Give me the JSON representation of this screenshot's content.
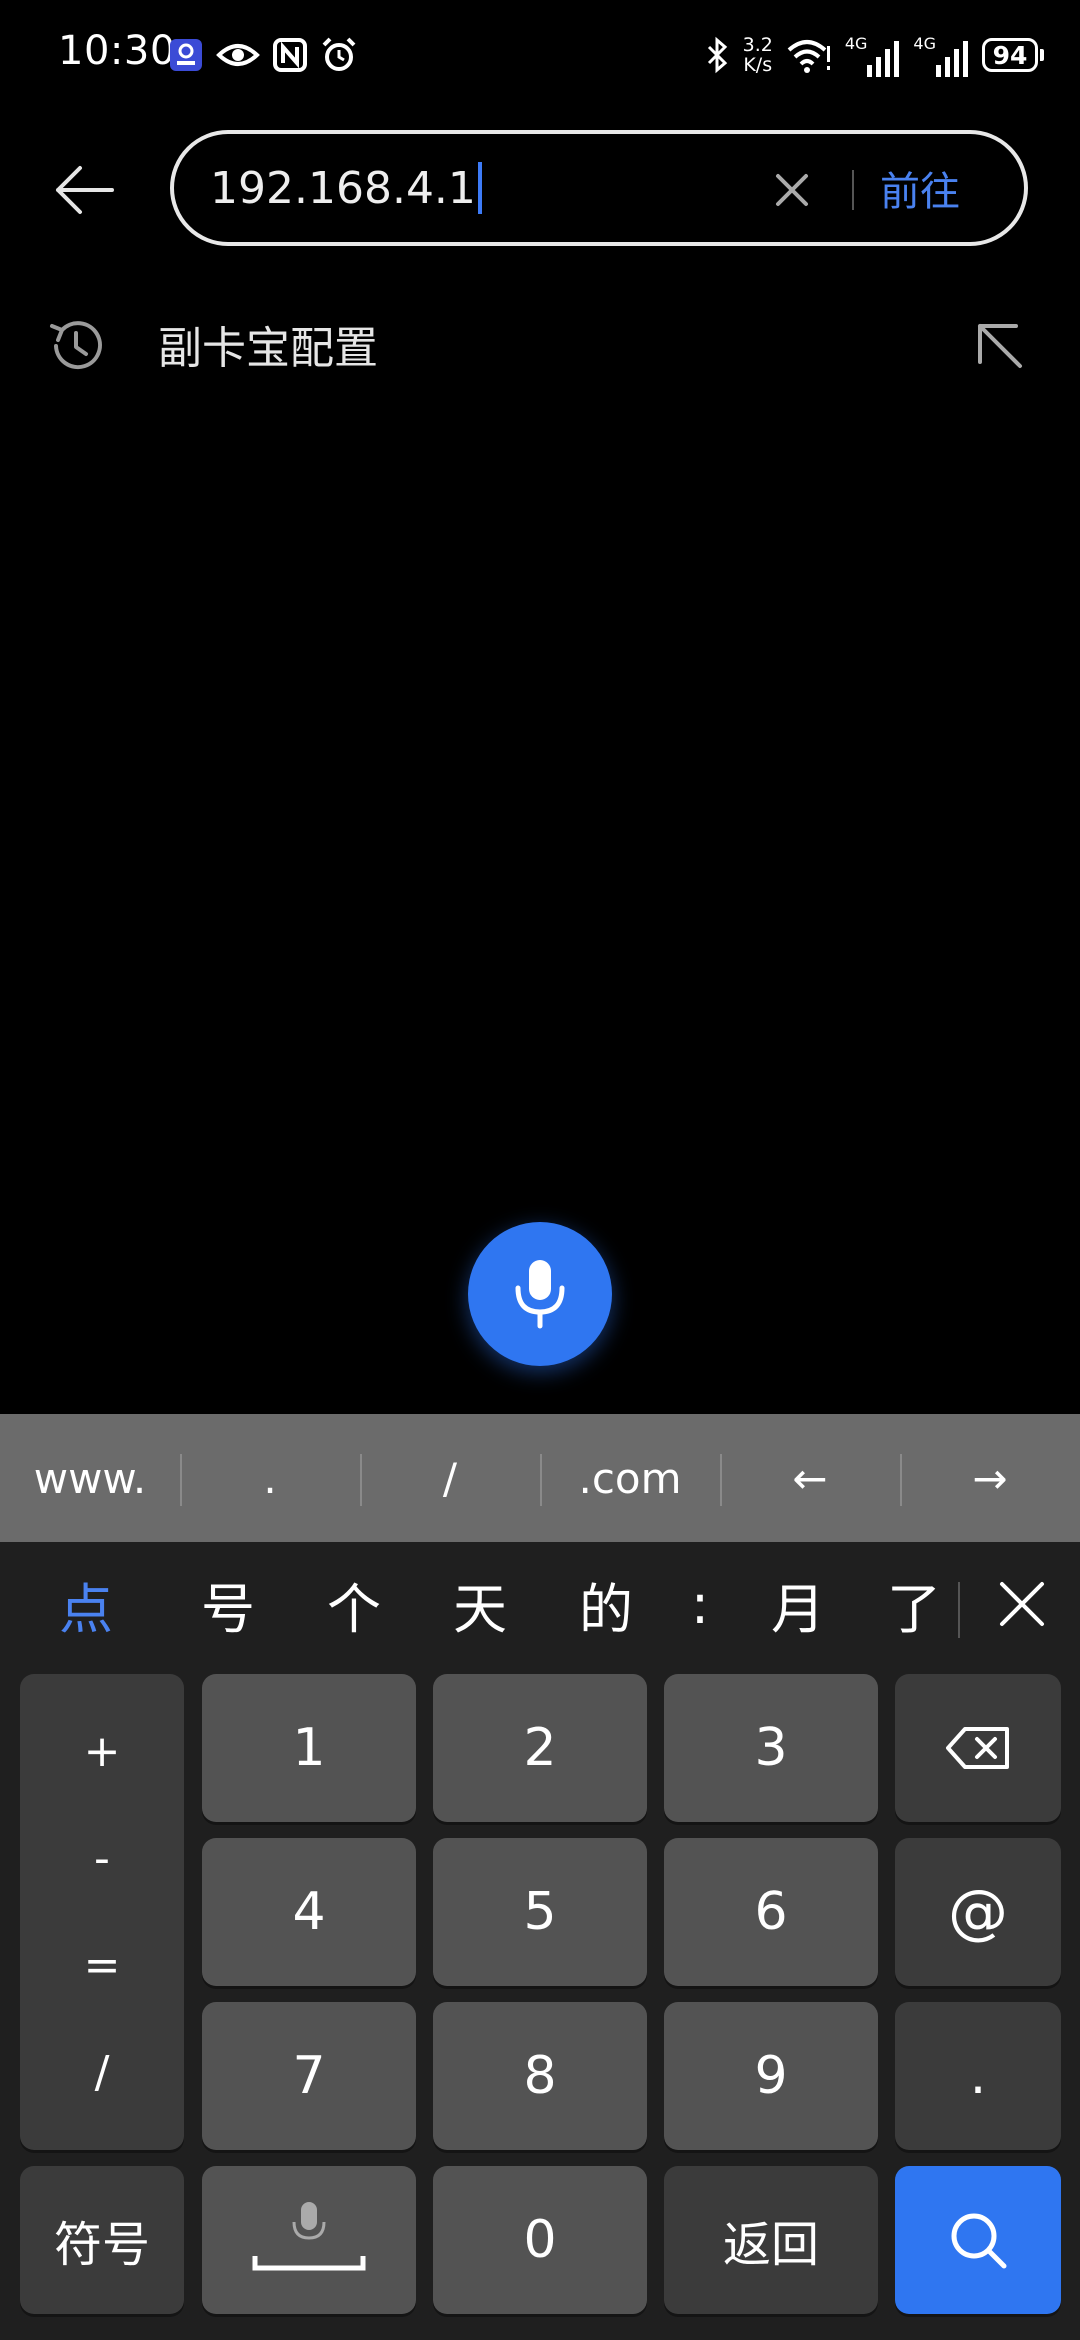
{
  "status_bar": {
    "time": "10:30",
    "speed_value": "3.2",
    "speed_unit": "K/s",
    "net1": "4G",
    "net2": "4G",
    "battery": "94",
    "icons": [
      "app-badge-icon",
      "eye-icon",
      "nfc-icon",
      "alarm-icon",
      "bluetooth-icon",
      "wifi-icon",
      "signal-icon"
    ]
  },
  "url_bar": {
    "value": "192.168.4.1",
    "go_label": "前往"
  },
  "suggestions": [
    {
      "label": "副卡宝配置",
      "icon": "history-icon"
    }
  ],
  "keyboard": {
    "shortcuts": [
      "www.",
      ".",
      "/",
      ".com",
      "←",
      "→"
    ],
    "candidates": [
      "点",
      "号",
      "个",
      "天",
      "的",
      ":",
      "月",
      "了"
    ],
    "symbols": [
      "+",
      "-",
      "=",
      "/"
    ],
    "digits": [
      "1",
      "2",
      "3",
      "4",
      "5",
      "6",
      "7",
      "8",
      "9",
      "0"
    ],
    "at_key": "@",
    "dot_key": ".",
    "symbol_key": "符号",
    "return_key": "返回"
  },
  "colors": {
    "accent": "#2f76f1",
    "link": "#4a82f0"
  }
}
